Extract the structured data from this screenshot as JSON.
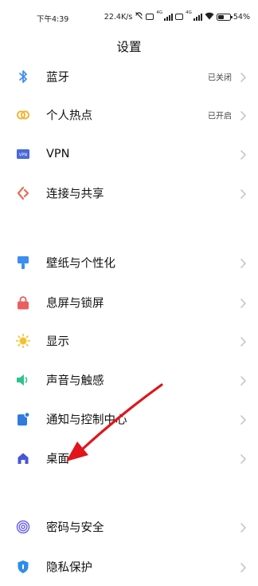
{
  "status_bar": {
    "time": "下午4:39",
    "network_speed": "22.4K/s",
    "network_4g_1": "4G",
    "network_4g_2": "4G",
    "battery_text": "54",
    "battery_level_percent": 54,
    "icons": [
      "dnd-icon",
      "sim1-icon",
      "signal1-icon",
      "sim2-icon",
      "signal2-icon",
      "wifi-icon",
      "battery-icon"
    ]
  },
  "header": {
    "title": "设置"
  },
  "settings": {
    "items": [
      {
        "key": "bluetooth",
        "label": "蓝牙",
        "value": "已关闭",
        "icon": "bluetooth-icon",
        "color": "#3d8ef0"
      },
      {
        "key": "hotspot",
        "label": "个人热点",
        "value": "已开启",
        "icon": "hotspot-icon",
        "color": "#f3b53a"
      },
      {
        "key": "vpn",
        "label": "VPN",
        "value": "",
        "icon": "vpn-icon",
        "color": "#4a69d8"
      },
      {
        "key": "connection-sharing",
        "label": "连接与共享",
        "value": "",
        "icon": "connection-sharing-icon",
        "color": "#ea6b52"
      },
      {
        "key": "wallpaper",
        "label": "壁纸与个性化",
        "value": "",
        "icon": "wallpaper-icon",
        "color": "#3b8ff0"
      },
      {
        "key": "lockscreen",
        "label": "息屏与锁屏",
        "value": "",
        "icon": "lock-icon",
        "color": "#e95f5f"
      },
      {
        "key": "display",
        "label": "显示",
        "value": "",
        "icon": "sun-icon",
        "color": "#f5c12d"
      },
      {
        "key": "sound",
        "label": "声音与触感",
        "value": "",
        "icon": "speaker-icon",
        "color": "#2fc38a"
      },
      {
        "key": "notification",
        "label": "通知与控制中心",
        "value": "",
        "icon": "notification-icon",
        "color": "#2f7be0"
      },
      {
        "key": "desktop",
        "label": "桌面",
        "value": "",
        "icon": "home-icon",
        "color": "#4656d8"
      },
      {
        "key": "password-security",
        "label": "密码与安全",
        "value": "",
        "icon": "fingerprint-icon",
        "color": "#7067e6"
      },
      {
        "key": "privacy",
        "label": "隐私保护",
        "value": "",
        "icon": "privacy-icon",
        "color": "#2f8de8"
      }
    ]
  },
  "annotation": {
    "arrow_color": "#e0161b",
    "icon": "red-arrow-annotation"
  },
  "colors": {
    "chevron": "#c8c8c8",
    "background": "#ffffff"
  }
}
